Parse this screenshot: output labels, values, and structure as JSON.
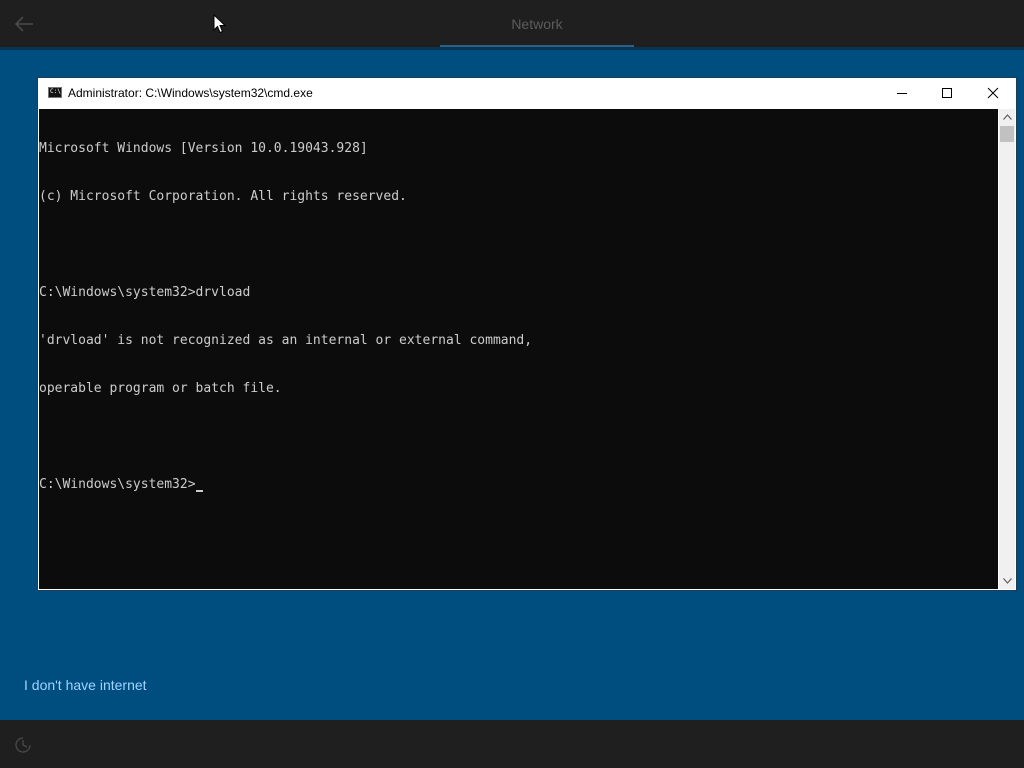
{
  "oobe": {
    "page_title": "Network",
    "back_icon": "back-arrow-icon",
    "no_internet_link": "I don't have internet",
    "accessibility_icon": "ease-of-access-icon"
  },
  "cmd": {
    "title": "Administrator: C:\\Windows\\system32\\cmd.exe",
    "lines": [
      "Microsoft Windows [Version 10.0.19043.928]",
      "(c) Microsoft Corporation. All rights reserved.",
      "",
      "C:\\Windows\\system32>drvload",
      "'drvload' is not recognized as an internal or external command,",
      "operable program or batch file.",
      "",
      "C:\\Windows\\system32>"
    ],
    "colors": {
      "background": "#0c0c0c",
      "text": "#cccccc"
    }
  },
  "colors": {
    "oobe_background": "#004d80",
    "topbar": "#1f1f1f",
    "link": "#9fd4ff"
  }
}
